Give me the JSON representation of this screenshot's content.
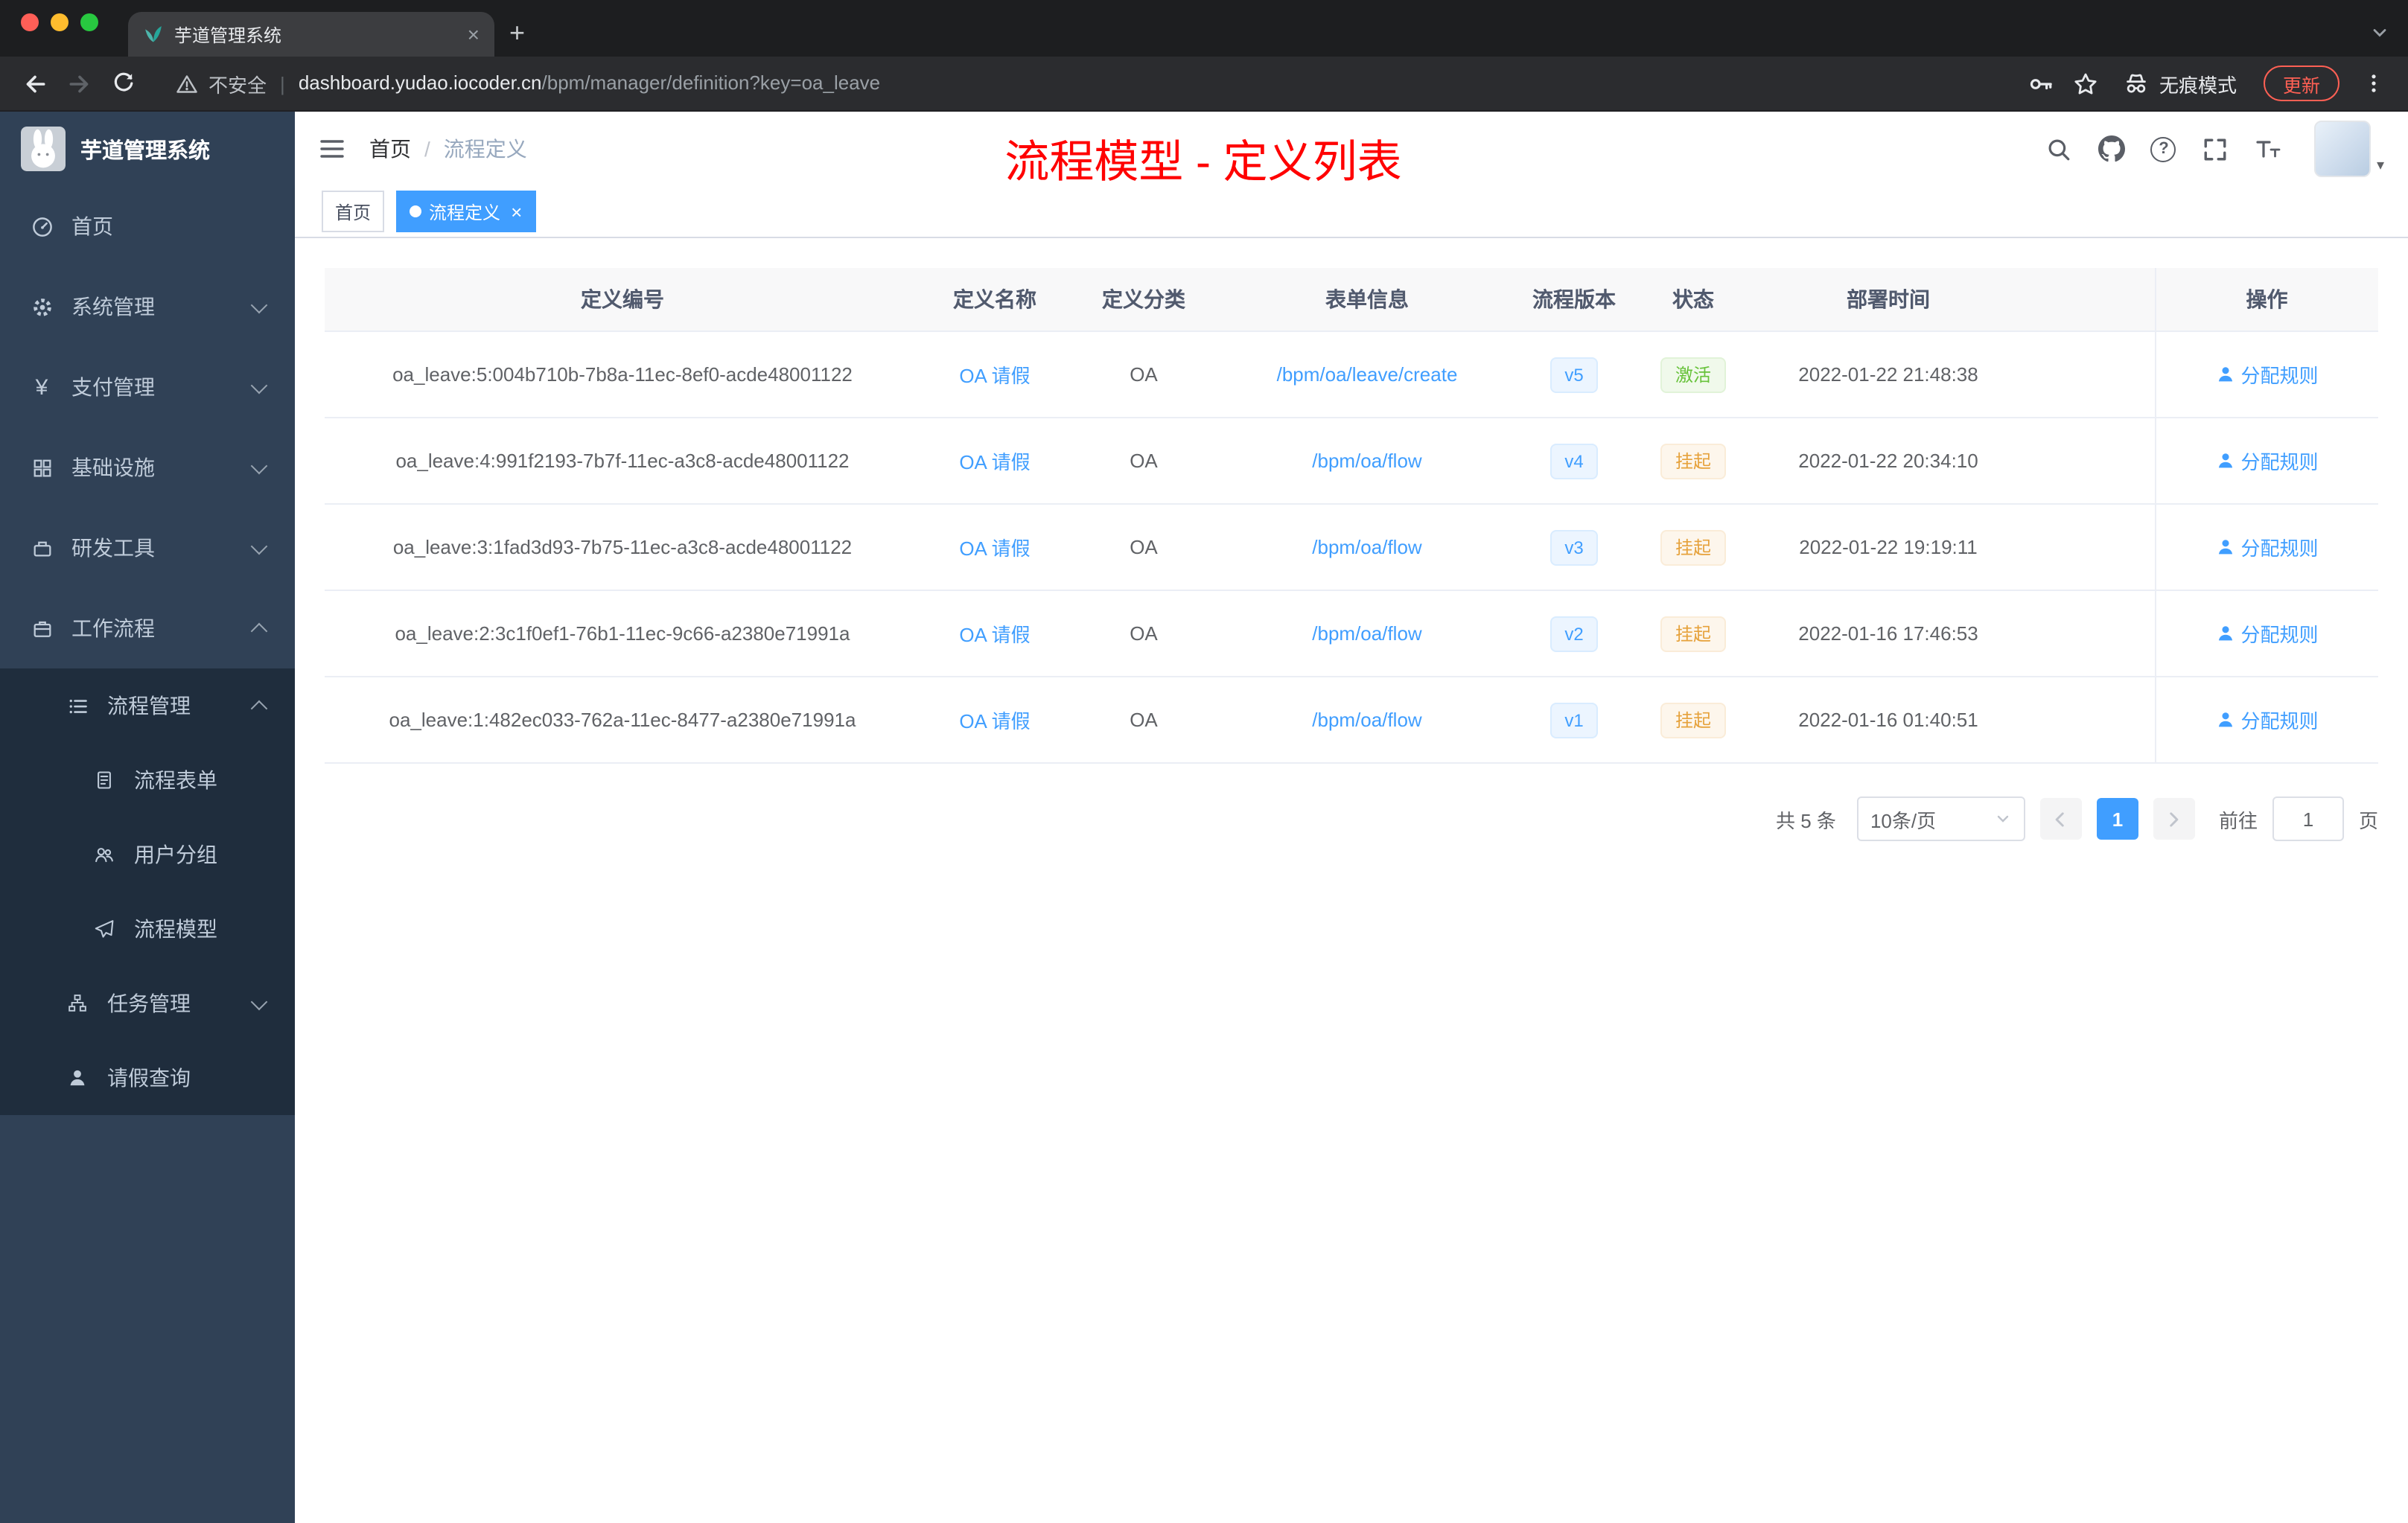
{
  "colors": {
    "accent": "#409eff",
    "annotation_red": "#ff0000",
    "success_text": "#67c23a",
    "warning_text": "#e6a23c",
    "sidebar_bg": "#304156",
    "submenu_bg": "#1f2d3d"
  },
  "browser": {
    "tab_title": "芋道管理系统",
    "security_label": "不安全",
    "url_domain": "dashboard.yudao.iocoder.cn",
    "url_path": "/bpm/manager/definition?key=oa_leave",
    "incognito_label": "无痕模式",
    "update_label": "更新"
  },
  "sidebar": {
    "logo_title": "芋道管理系统",
    "items": [
      {
        "label": "首页"
      },
      {
        "label": "系统管理"
      },
      {
        "label": "支付管理"
      },
      {
        "label": "基础设施"
      },
      {
        "label": "研发工具"
      },
      {
        "label": "工作流程"
      },
      {
        "label": "流程管理"
      },
      {
        "label": "流程表单"
      },
      {
        "label": "用户分组"
      },
      {
        "label": "流程模型"
      },
      {
        "label": "任务管理"
      },
      {
        "label": "请假查询"
      }
    ]
  },
  "header": {
    "breadcrumb_home": "首页",
    "breadcrumb_separator": "/",
    "breadcrumb_current": "流程定义",
    "annotation": "流程模型 - 定义列表"
  },
  "tags": {
    "home": "首页",
    "active": "流程定义"
  },
  "table": {
    "columns": [
      "定义编号",
      "定义名称",
      "定义分类",
      "表单信息",
      "流程版本",
      "状态",
      "部署时间",
      "操作"
    ],
    "rows": [
      {
        "id": "oa_leave:5:004b710b-7b8a-11ec-8ef0-acde48001122",
        "name": "OA 请假",
        "category": "OA",
        "form": "/bpm/oa/leave/create",
        "version": "v5",
        "status": "激活",
        "time": "2022-01-22 21:48:38",
        "action": "分配规则"
      },
      {
        "id": "oa_leave:4:991f2193-7b7f-11ec-a3c8-acde48001122",
        "name": "OA 请假",
        "category": "OA",
        "form": "/bpm/oa/flow",
        "version": "v4",
        "status": "挂起",
        "time": "2022-01-22 20:34:10",
        "action": "分配规则"
      },
      {
        "id": "oa_leave:3:1fad3d93-7b75-11ec-a3c8-acde48001122",
        "name": "OA 请假",
        "category": "OA",
        "form": "/bpm/oa/flow",
        "version": "v3",
        "status": "挂起",
        "time": "2022-01-22 19:19:11",
        "action": "分配规则"
      },
      {
        "id": "oa_leave:2:3c1f0ef1-76b1-11ec-9c66-a2380e71991a",
        "name": "OA 请假",
        "category": "OA",
        "form": "/bpm/oa/flow",
        "version": "v2",
        "status": "挂起",
        "time": "2022-01-16 17:46:53",
        "action": "分配规则"
      },
      {
        "id": "oa_leave:1:482ec033-762a-11ec-8477-a2380e71991a",
        "name": "OA 请假",
        "category": "OA",
        "form": "/bpm/oa/flow",
        "version": "v1",
        "status": "挂起",
        "time": "2022-01-16 01:40:51",
        "action": "分配规则"
      }
    ]
  },
  "pagination": {
    "total": "共 5 条",
    "page_size": "10条/页",
    "current_page": "1",
    "goto_label": "前往",
    "goto_value": "1",
    "page_unit": "页"
  }
}
